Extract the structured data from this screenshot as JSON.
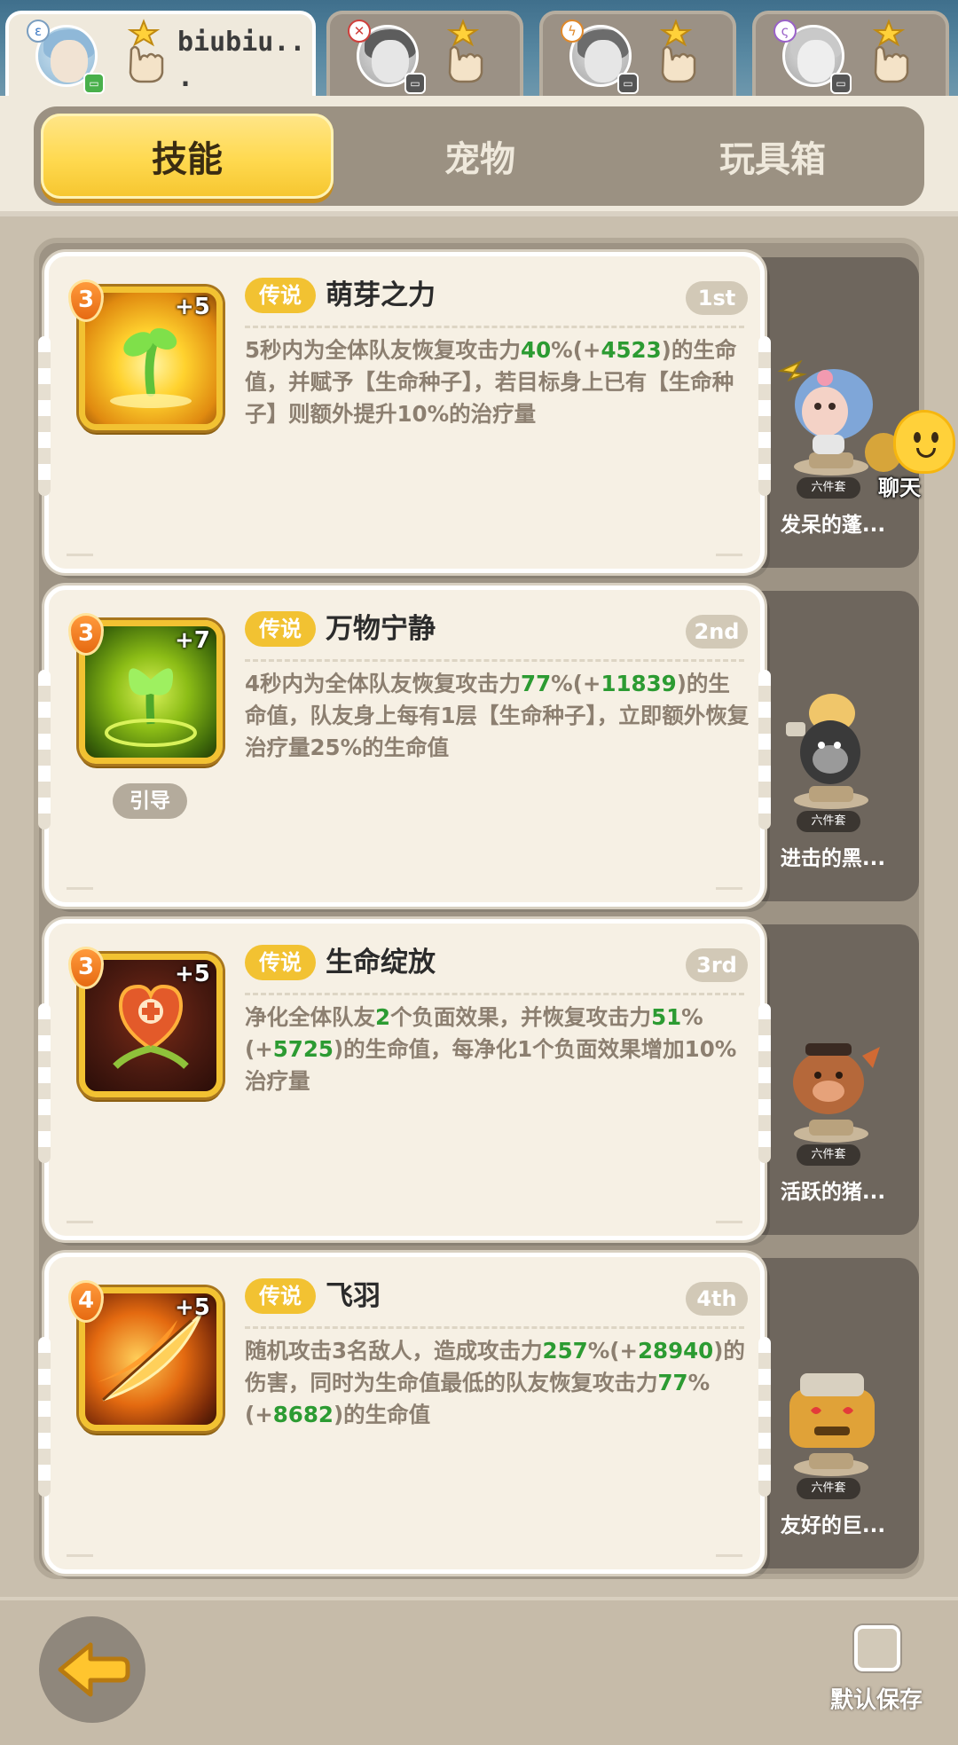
{
  "characters": [
    {
      "name": "biubiu..\n.",
      "active": true
    },
    {
      "name": "",
      "active": false
    },
    {
      "name": "",
      "active": false
    },
    {
      "name": "",
      "active": false
    }
  ],
  "tabs": [
    "技能",
    "宠物",
    "玩具箱"
  ],
  "active_tab": 0,
  "skills": [
    {
      "level": "3",
      "plus": "+5",
      "tag": "传说",
      "title": "萌芽之力",
      "rank": "1st",
      "desc_parts": [
        {
          "t": "5秒内为全体队友恢复攻击力"
        },
        {
          "t": "40",
          "g": true
        },
        {
          "t": "%(+"
        },
        {
          "t": "4523",
          "g": true
        },
        {
          "t": ")的生命值，并赋予【生命种子】，若目标身上已有【生命种子】则额外提升10%的治疗量"
        }
      ],
      "guide": "",
      "pet_name": "发呆的蓬...",
      "set_tag": "六件套"
    },
    {
      "level": "3",
      "plus": "+7",
      "tag": "传说",
      "title": "万物宁静",
      "rank": "2nd",
      "desc_parts": [
        {
          "t": "4秒内为全体队友恢复攻击力"
        },
        {
          "t": "77",
          "g": true
        },
        {
          "t": "%(+"
        },
        {
          "t": "11839",
          "g": true
        },
        {
          "t": ")的生命值，队友身上每有1层【生命种子】，立即额外恢复治疗量25%的生命值"
        }
      ],
      "guide": "引导",
      "pet_name": "进击的黑...",
      "set_tag": "六件套"
    },
    {
      "level": "3",
      "plus": "+5",
      "tag": "传说",
      "title": "生命绽放",
      "rank": "3rd",
      "desc_parts": [
        {
          "t": "净化全体队友"
        },
        {
          "t": "2",
          "g": true
        },
        {
          "t": "个负面效果，并恢复攻击力"
        },
        {
          "t": "51",
          "g": true
        },
        {
          "t": "%(+"
        },
        {
          "t": "5725",
          "g": true
        },
        {
          "t": ")的生命值，每净化1个负面效果增加10%治疗量"
        }
      ],
      "guide": "",
      "pet_name": "活跃的猪...",
      "set_tag": "六件套"
    },
    {
      "level": "4",
      "plus": "+5",
      "tag": "传说",
      "title": "飞羽",
      "rank": "4th",
      "desc_parts": [
        {
          "t": "随机攻击3名敌人，造成攻击力"
        },
        {
          "t": "257",
          "g": true
        },
        {
          "t": "%(+"
        },
        {
          "t": "28940",
          "g": true
        },
        {
          "t": ")的伤害，同时为生命值最低的队友恢复攻击力"
        },
        {
          "t": "77",
          "g": true
        },
        {
          "t": "%(+"
        },
        {
          "t": "8682",
          "g": true
        },
        {
          "t": ")的生命值"
        }
      ],
      "guide": "",
      "pet_name": "友好的巨...",
      "set_tag": "六件套"
    }
  ],
  "chat_label": "聊天",
  "save_label": "默认保存",
  "colors": {
    "accent": "#f2c232",
    "value_green": "#2c9b32",
    "desc_text": "#8c7f70"
  }
}
